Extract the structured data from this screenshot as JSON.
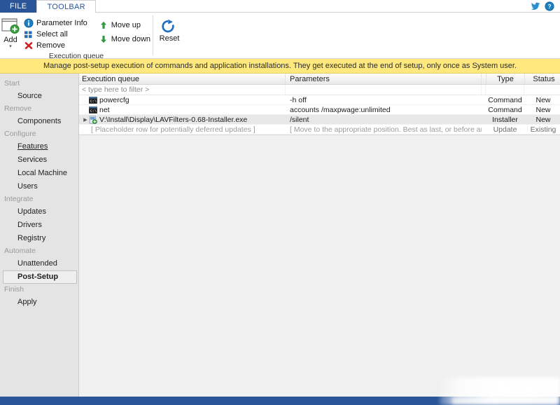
{
  "window": {
    "tabs": [
      {
        "label": "FILE",
        "name": "tab-file",
        "active": false
      },
      {
        "label": "TOOLBAR",
        "name": "tab-toolbar",
        "active": true
      }
    ],
    "header_icons": [
      {
        "name": "twitter-icon",
        "title": "Twitter"
      },
      {
        "name": "help-icon",
        "title": "Help"
      }
    ]
  },
  "ribbon": {
    "group_label": "Execution queue",
    "add_button": {
      "label": "Add",
      "caret": "▾",
      "icon": "add-window-icon"
    },
    "commands": [
      {
        "label": "Parameter Info",
        "icon": "info-icon",
        "name": "parameter-info-button"
      },
      {
        "label": "Select all",
        "icon": "select-all-icon",
        "name": "select-all-button"
      },
      {
        "label": "Remove",
        "icon": "remove-x-icon",
        "name": "remove-button"
      }
    ],
    "move_commands": [
      {
        "label": "Move up",
        "icon": "arrow-up-icon",
        "name": "move-up-button"
      },
      {
        "label": "Move down",
        "icon": "arrow-down-icon",
        "name": "move-down-button"
      }
    ],
    "reset_button": {
      "label": "Reset",
      "icon": "refresh-icon",
      "name": "reset-button"
    }
  },
  "notice": {
    "text": "Manage post-setup execution of commands and application installations. They get executed at the end of setup, only once as System user."
  },
  "sidebar": {
    "groups": [
      {
        "label": "Start",
        "items": [
          {
            "label": "Source",
            "state": "normal"
          }
        ]
      },
      {
        "label": "Remove",
        "items": [
          {
            "label": "Components",
            "state": "normal"
          }
        ]
      },
      {
        "label": "Configure",
        "items": [
          {
            "label": "Features",
            "state": "hover"
          },
          {
            "label": "Services",
            "state": "normal"
          },
          {
            "label": "Local Machine",
            "state": "normal"
          },
          {
            "label": "Users",
            "state": "normal"
          }
        ]
      },
      {
        "label": "Integrate",
        "items": [
          {
            "label": "Updates",
            "state": "normal"
          },
          {
            "label": "Drivers",
            "state": "normal"
          },
          {
            "label": "Registry",
            "state": "normal"
          }
        ]
      },
      {
        "label": "Automate",
        "items": [
          {
            "label": "Unattended",
            "state": "normal"
          },
          {
            "label": "Post-Setup",
            "state": "selected"
          }
        ]
      },
      {
        "label": "Finish",
        "items": [
          {
            "label": "Apply",
            "state": "normal"
          }
        ]
      }
    ]
  },
  "grid": {
    "columns": [
      {
        "label": "Execution queue",
        "key": "name"
      },
      {
        "label": "Parameters",
        "key": "params"
      },
      {
        "label": "Type",
        "key": "type"
      },
      {
        "label": "Status",
        "key": "status"
      }
    ],
    "filter_placeholder": "< type here to filter >",
    "rows": [
      {
        "name": "powercfg",
        "params": "-h off",
        "type": "Command",
        "status": "New",
        "icon": "console-icon",
        "expander": false,
        "selected": false,
        "muted": false
      },
      {
        "name": "net",
        "params": "accounts /maxpwage:unlimited",
        "type": "Command",
        "status": "New",
        "icon": "console-icon",
        "expander": false,
        "selected": false,
        "muted": false
      },
      {
        "name": "V:\\Install\\Display\\LAVFilters-0.68-Installer.exe",
        "params": "/silent",
        "type": "Installer",
        "status": "New",
        "icon": "installer-icon",
        "expander": true,
        "selected": true,
        "muted": false
      },
      {
        "name": "[ Placeholder row for potentially deferred updates ]",
        "params": "[ Move to the appropriate position. Best as last, or before any conflicting executi...",
        "type": "Update",
        "status": "Existing",
        "icon": "none",
        "expander": false,
        "selected": false,
        "muted": true
      }
    ]
  },
  "colors": {
    "accent_blue": "#2a5699",
    "notice_yellow": "#ffe97f",
    "sidebar_gray": "#e4e4e4",
    "selected_row": "#e8e8e8",
    "green_arrow": "#2e9b3e",
    "red_x": "#cc2222"
  }
}
